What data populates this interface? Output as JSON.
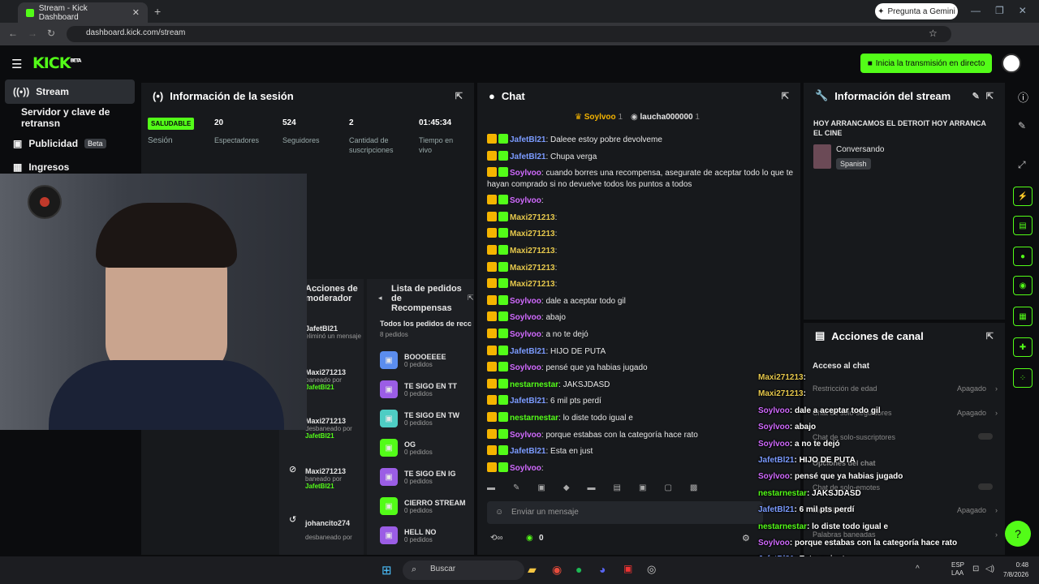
{
  "browser": {
    "tab_title": "Stream - Kick Dashboard",
    "url": "dashboard.kick.com/stream",
    "gemini_button": "Pregunta a Gemini"
  },
  "header": {
    "logo": "KICK",
    "logo_tag": "BETA",
    "golive": "Inicia la transmisión en directo"
  },
  "sidebar": {
    "items": [
      {
        "label": "Stream"
      },
      {
        "label": "Servidor y clave de retransn"
      },
      {
        "label": "Publicidad",
        "badge": "Beta"
      },
      {
        "label": "Ingresos"
      }
    ]
  },
  "session": {
    "title": "Información de la sesión",
    "health": "SALUDABLE",
    "health_label": "Sesión",
    "stats": [
      {
        "value": "20",
        "label": "Espectadores"
      },
      {
        "value": "524",
        "label": "Seguidores"
      },
      {
        "value": "2",
        "label": "Cantidad de suscripciones"
      },
      {
        "value": "01:45:34",
        "label": "Tiempo en vivo"
      }
    ]
  },
  "modactions": {
    "title": "Acciones de moderador",
    "items": [
      {
        "user": "JafetBl21",
        "time": "hace minut",
        "action": "eliminó un mensaje",
        "by": ""
      },
      {
        "user": "Maxi271213",
        "time": "ha mi",
        "action": "baneado por",
        "by": "JafetBl21"
      },
      {
        "user": "Maxi271213",
        "time": "ha mi",
        "action": "desbaneado por",
        "by": "JafetBl21"
      },
      {
        "user": "Maxi271213",
        "time": "ha mi",
        "action": "baneado por",
        "by": "JafetBl21"
      },
      {
        "user": "johancito274",
        "time": "",
        "action": "desbaneado por",
        "by": "JafetBl21"
      }
    ]
  },
  "rewards": {
    "title": "Lista de pedidos de Recompensas",
    "subtitle": "Todos los pedidos de recc",
    "count": "8 pedidos",
    "items": [
      {
        "name": "BOOOEEEE",
        "orders": "0 pedidos",
        "color": "#5b8def"
      },
      {
        "name": "TE SIGO EN TT",
        "orders": "0 pedidos",
        "color": "#9b5de5"
      },
      {
        "name": "TE SIGO EN TW",
        "orders": "0 pedidos",
        "color": "#4ecdc4"
      },
      {
        "name": "OG",
        "orders": "0 pedidos",
        "color": "#53fc18"
      },
      {
        "name": "TE SIGO EN IG",
        "orders": "0 pedidos",
        "color": "#9b5de5"
      },
      {
        "name": "CIERRO STREAM",
        "orders": "0 pedidos",
        "color": "#53fc18"
      },
      {
        "name": "HELL NO",
        "orders": "0 pedidos",
        "color": "#9b5de5"
      }
    ]
  },
  "chat": {
    "title": "Chat",
    "top_users": [
      {
        "name": "Soylvoo",
        "count": "1"
      },
      {
        "name": "laucha000000",
        "count": "1"
      }
    ],
    "messages": [
      {
        "user": "JafetBl21",
        "text": ": Daleee estoy pobre devolveme",
        "color": "#7b9bff"
      },
      {
        "user": "JafetBl21",
        "text": ": Chupa verga",
        "color": "#7b9bff"
      },
      {
        "user": "Soylvoo",
        "text": ": cuando borres una recompensa, asegurate de aceptar todo lo que te hayan comprado si no devuelve todos los puntos a todos",
        "color": "#d16aff"
      },
      {
        "user": "Soylvoo",
        "text": ":",
        "color": "#d16aff"
      },
      {
        "user": "Maxi271213",
        "text": ":",
        "color": "#e6c84c"
      },
      {
        "user": "Maxi271213",
        "text": ":",
        "color": "#e6c84c"
      },
      {
        "user": "Maxi271213",
        "text": ":",
        "color": "#e6c84c"
      },
      {
        "user": "Maxi271213",
        "text": ":",
        "color": "#e6c84c"
      },
      {
        "user": "Maxi271213",
        "text": ":",
        "color": "#e6c84c"
      },
      {
        "user": "Soylvoo",
        "text": ": dale a aceptar todo gil",
        "color": "#d16aff"
      },
      {
        "user": "Soylvoo",
        "text": ": abajo",
        "color": "#d16aff"
      },
      {
        "user": "Soylvoo",
        "text": ": a no te dejó",
        "color": "#d16aff"
      },
      {
        "user": "JafetBl21",
        "text": ": HIJO DE PUTA",
        "color": "#7b9bff"
      },
      {
        "user": "Soylvoo",
        "text": ": pensé que ya habias jugado",
        "color": "#d16aff"
      },
      {
        "user": "nestarnestar",
        "text": ": JAKSJDASD",
        "color": "#53fc18"
      },
      {
        "user": "JafetBl21",
        "text": ": 6 mil pts perdí",
        "color": "#7b9bff"
      },
      {
        "user": "nestarnestar",
        "text": ": lo diste todo igual e",
        "color": "#53fc18"
      },
      {
        "user": "Soylvoo",
        "text": ": porque estabas con la categoría hace rato",
        "color": "#d16aff"
      },
      {
        "user": "JafetBl21",
        "text": ": Esta en just",
        "color": "#7b9bff"
      },
      {
        "user": "Soylvoo",
        "text": ":",
        "color": "#d16aff"
      }
    ],
    "input_placeholder": "Enviar un mensaje",
    "points": "0"
  },
  "streaminfo": {
    "title": "Información del stream",
    "stream_title": "HOY ARRANCAMOS EL DETROIT HOY ARRANCA EL CINE",
    "category": "Conversando",
    "language": "Spanish"
  },
  "channel": {
    "title": "Acciones de canal",
    "section": "Acceso al chat",
    "rows": [
      {
        "label": "Restricción de edad",
        "value": "Apagado"
      },
      {
        "label": "Chat de solo-seguidores",
        "value": "Apagado"
      },
      {
        "label": "Chat de solo-suscriptores",
        "value": ""
      },
      {
        "label": "Opciones del chat",
        "value": ""
      },
      {
        "label": "Chat de solo-emotes",
        "value": ""
      },
      {
        "label": "Modo lento",
        "value": "Apagado"
      },
      {
        "label": "Palabras baneadas",
        "value": ""
      }
    ]
  },
  "overlay": {
    "messages": [
      {
        "user": "Maxi271213",
        "text": ":",
        "color": "#e6c84c"
      },
      {
        "user": "Maxi271213",
        "text": ":",
        "color": "#e6c84c"
      },
      {
        "user": "Soylvoo",
        "text": ": dale a aceptar todo gil",
        "color": "#d16aff"
      },
      {
        "user": "Soylvoo",
        "text": ": abajo",
        "color": "#d16aff"
      },
      {
        "user": "Soylvoo",
        "text": ": a no te dejó",
        "color": "#d16aff"
      },
      {
        "user": "JafetBl21",
        "text": ": HIJO DE PUTA",
        "color": "#7b9bff"
      },
      {
        "user": "Soylvoo",
        "text": ": pensé que ya habias jugado",
        "color": "#d16aff"
      },
      {
        "user": "nestarnestar",
        "text": ": JAKSJDASD",
        "color": "#53fc18"
      },
      {
        "user": "JafetBl21",
        "text": ": 6 mil pts perdí",
        "color": "#7b9bff"
      },
      {
        "user": "nestarnestar",
        "text": ": lo diste todo igual e",
        "color": "#53fc18"
      },
      {
        "user": "Soylvoo",
        "text": ": porque estabas con la categoría hace rato",
        "color": "#d16aff"
      },
      {
        "user": "JafetBl21",
        "text": ": Esta en just",
        "color": "#7b9bff"
      },
      {
        "user": "Soylvoo",
        "text": ":",
        "color": "#d16aff"
      }
    ]
  },
  "taskbar": {
    "search": "Buscar",
    "lang": "ESP",
    "lang2": "LAA",
    "time": "0:48",
    "date": "7/8/2026"
  }
}
